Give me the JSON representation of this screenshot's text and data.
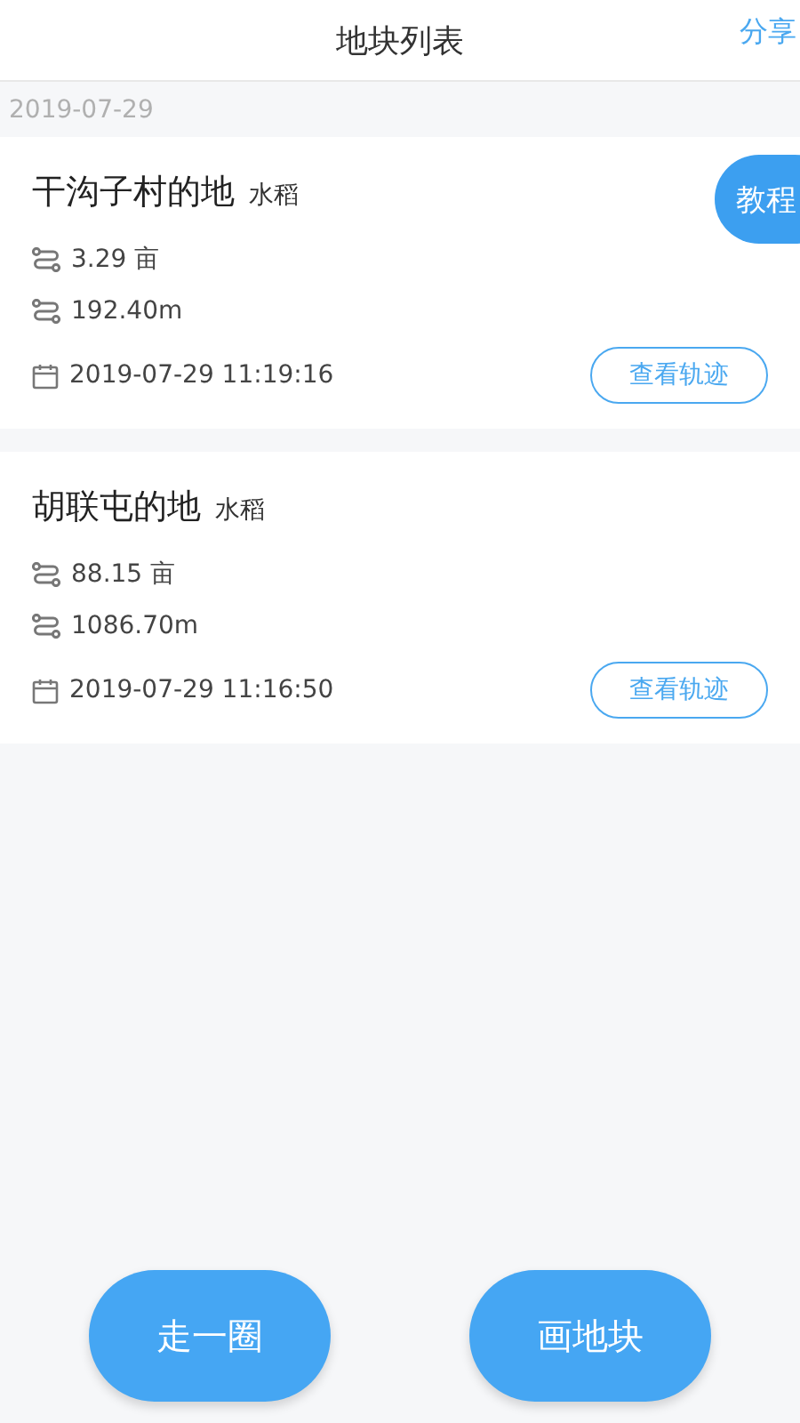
{
  "header": {
    "title": "地块列表",
    "action": "分享"
  },
  "date_group": "2019-07-29",
  "tutorial_button": "教程",
  "plots": [
    {
      "name": "干沟子村的地",
      "crop": "水稻",
      "area": "3.29 亩",
      "perimeter": "192.40m",
      "time": "2019-07-29 11:19:16",
      "track_button": "查看轨迹"
    },
    {
      "name": "胡联屯的地",
      "crop": "水稻",
      "area": "88.15 亩",
      "perimeter": "1086.70m",
      "time": "2019-07-29 11:16:50",
      "track_button": "查看轨迹"
    }
  ],
  "bottom_buttons": [
    "走一圈",
    "画地块"
  ]
}
